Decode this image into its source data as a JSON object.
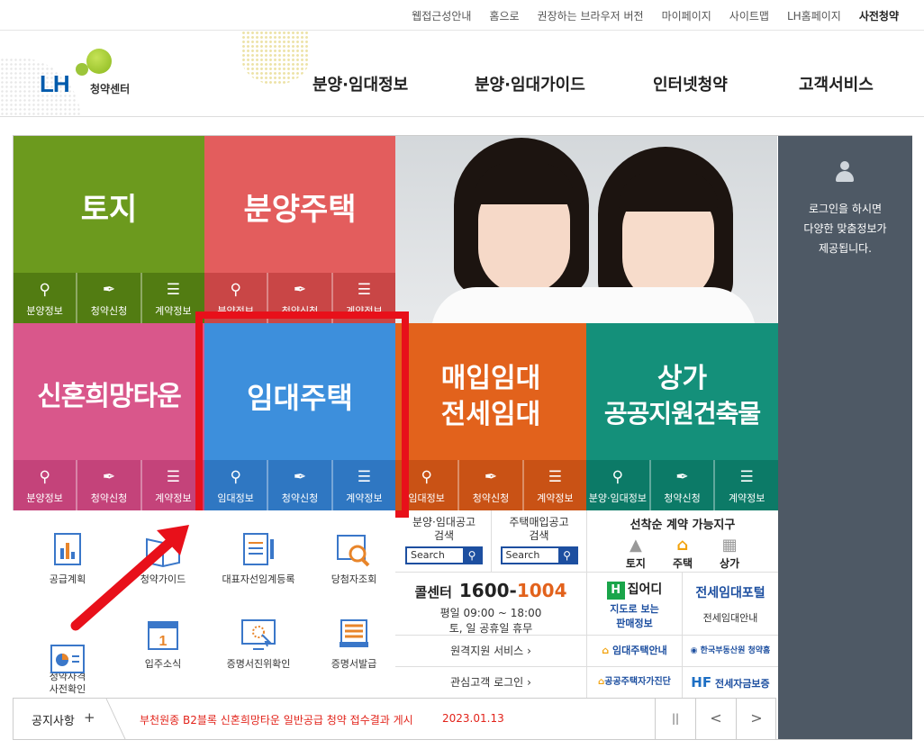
{
  "top_util": [
    "웹접근성안내",
    "홈으로",
    "권장하는 브라우저 버전",
    "마이페이지",
    "사이트맵",
    "LH홈페이지",
    "사전청약"
  ],
  "logo": {
    "brand": "LH",
    "sub": "청약센터"
  },
  "gnb": [
    "분양·임대정보",
    "분양·임대가이드",
    "인터넷청약",
    "고객서비스"
  ],
  "tiles": {
    "land": {
      "title": "토지",
      "subs": [
        "분양정보",
        "청약신청",
        "계약정보"
      ],
      "color": "#6c9a1e"
    },
    "sale": {
      "title": "분양주택",
      "subs": [
        "분양정보",
        "청약신청",
        "계약정보"
      ],
      "color": "#e35d5d"
    },
    "newlywed": {
      "title": "신혼희망타운",
      "subs": [
        "분양정보",
        "청약신청",
        "계약정보"
      ],
      "color": "#d9578b"
    },
    "rental": {
      "title": "임대주택",
      "subs": [
        "임대정보",
        "청약신청",
        "계약정보"
      ],
      "color": "#3d8fdc"
    },
    "purchase": {
      "title1": "매입임대",
      "title2": "전세임대",
      "subs": [
        "임대정보",
        "청약신청",
        "계약정보"
      ],
      "color": "#e2621c"
    },
    "commercial": {
      "title1": "상가",
      "title2": "공공지원건축물",
      "subs": [
        "분양·임대정보",
        "청약신청",
        "계약정보"
      ],
      "color": "#14907a"
    }
  },
  "side": {
    "line1": "로그인을 하시면",
    "line2": "다양한 맞춤정보가",
    "line3": "제공됩니다."
  },
  "quick_menu": [
    "공급계획",
    "청약가이드",
    "대표자선임계등록",
    "당첨자조회",
    "청약자격\n사전확인",
    "입주소식",
    "증명서진위확인",
    "증명서발급"
  ],
  "search_boxes": [
    {
      "line1": "분양·임대공고",
      "line2": "검색",
      "placeholder": "Search"
    },
    {
      "line1": "주택매입공고",
      "line2": "검색",
      "placeholder": "Search"
    }
  ],
  "first_come": {
    "title": "선착순 계약 가능지구",
    "items": [
      "토지",
      "주택",
      "상가"
    ]
  },
  "call_center": {
    "label": "콜센터",
    "number_a": "1600-",
    "number_b": "1004",
    "hours": "평일 09:00 ~ 18:00",
    "closed": "토, 일 공휴일 휴무"
  },
  "links": [
    "원격지원 서비스",
    "관심고객 로그인"
  ],
  "zipeodi": {
    "brand": "집어디",
    "desc1": "지도로 보는",
    "desc2": "판매정보"
  },
  "portal": {
    "title": "전세임대포털",
    "sub": "전세임대안내"
  },
  "banners": [
    "임대주택안내",
    "한국부동산원 청약홈",
    "공공주택자가진단",
    "전세자금보증"
  ],
  "notice": {
    "label": "공지사항",
    "plus": "+",
    "headline": "부천원종 B2블록 신혼희망타운 일반공급 청약 접수결과 게시",
    "date": "2023.01.13",
    "controls": [
      "||",
      "<",
      ">"
    ]
  },
  "colors": {
    "highlight": "#e8101a",
    "navy": "#1d4fa0",
    "side_bg": "#4e5965"
  }
}
